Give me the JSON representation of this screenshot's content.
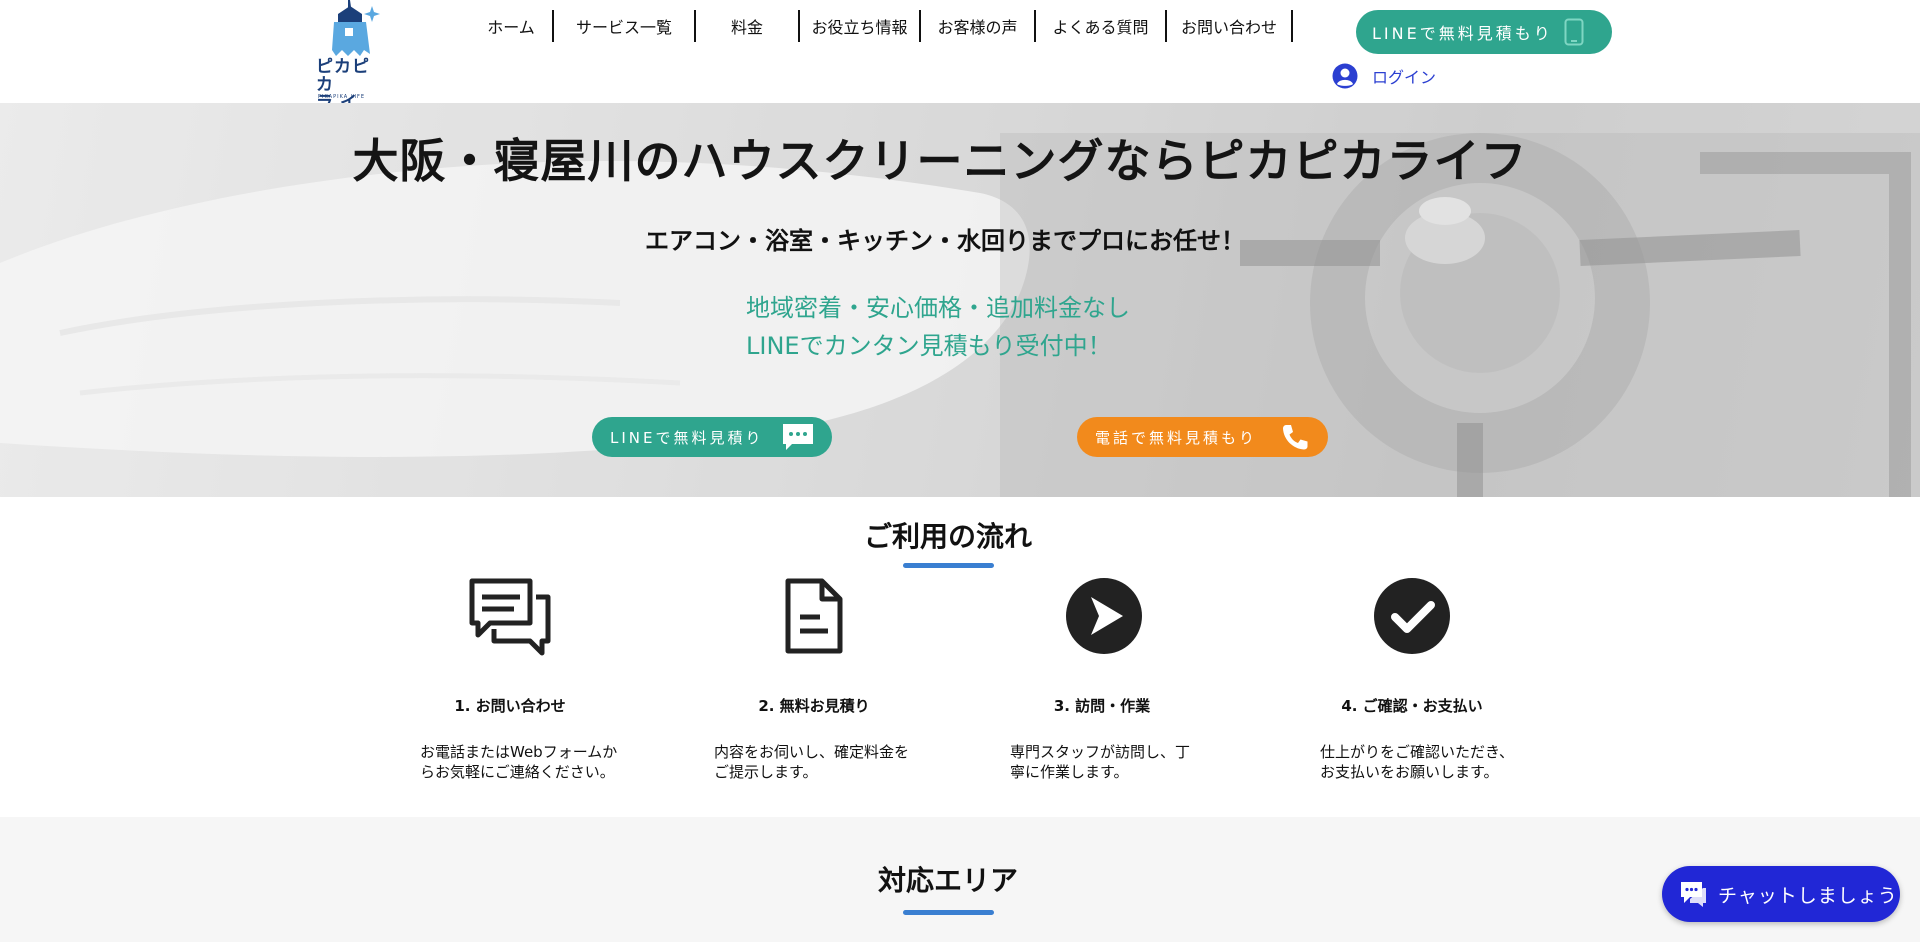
{
  "brand": {
    "logo_text_line1": "ピカピカ",
    "logo_text_line2": "ライフ",
    "logo_sub": "PIKAPIKA LIFE"
  },
  "nav": {
    "items": [
      {
        "label": "ホーム"
      },
      {
        "label": "サービス一覧"
      },
      {
        "label": "料金"
      },
      {
        "label": "お役立ち情報"
      },
      {
        "label": "お客様の声"
      },
      {
        "label": "よくある質問"
      },
      {
        "label": "お問い合わせ"
      }
    ],
    "line_button": "LINEで無料見積もり",
    "login": "ログイン"
  },
  "hero": {
    "title": "大阪・寝屋川のハウスクリーニングならピカピカライフ",
    "subtitle": "エアコン・浴室・キッチン・水回りまでプロにお任せ！",
    "green_line1": "地域密着・安心価格・追加料金なし",
    "green_line2": "LINEでカンタン見積もり受付中！",
    "line_button": "LINEで無料見積り",
    "tel_button": "電話で無料見積もり"
  },
  "flow": {
    "title": "ご利用の流れ",
    "steps": [
      {
        "title": "1. お問い合わせ",
        "desc_line1": "お電話またはWebフォームか",
        "desc_line2": "らお気軽にご連絡ください。",
        "icon": "chat-bubbles-icon"
      },
      {
        "title": "2. 無料お見積り",
        "desc_line1": "内容をお伺いし、確定料金を",
        "desc_line2": "ご提示します。",
        "icon": "document-icon"
      },
      {
        "title": "3. 訪問・作業",
        "desc_line1": "専門スタッフが訪問し、丁",
        "desc_line2": "寧に作業します。",
        "icon": "arrow-circle-icon"
      },
      {
        "title": "4. ご確認・お支払い",
        "desc_line1": "仕上がりをご確認いただき、",
        "desc_line2": "お支払いをお願いします。",
        "icon": "check-circle-icon"
      }
    ]
  },
  "area": {
    "title": "対応エリア"
  },
  "chat": {
    "label": "チャットしましょう"
  },
  "colors": {
    "accent_green": "#2fa58e",
    "accent_orange": "#f28a1c",
    "underline_blue": "#3a7fd1",
    "chat_blue": "#2127d6",
    "login_blue": "#2b3fd1"
  }
}
